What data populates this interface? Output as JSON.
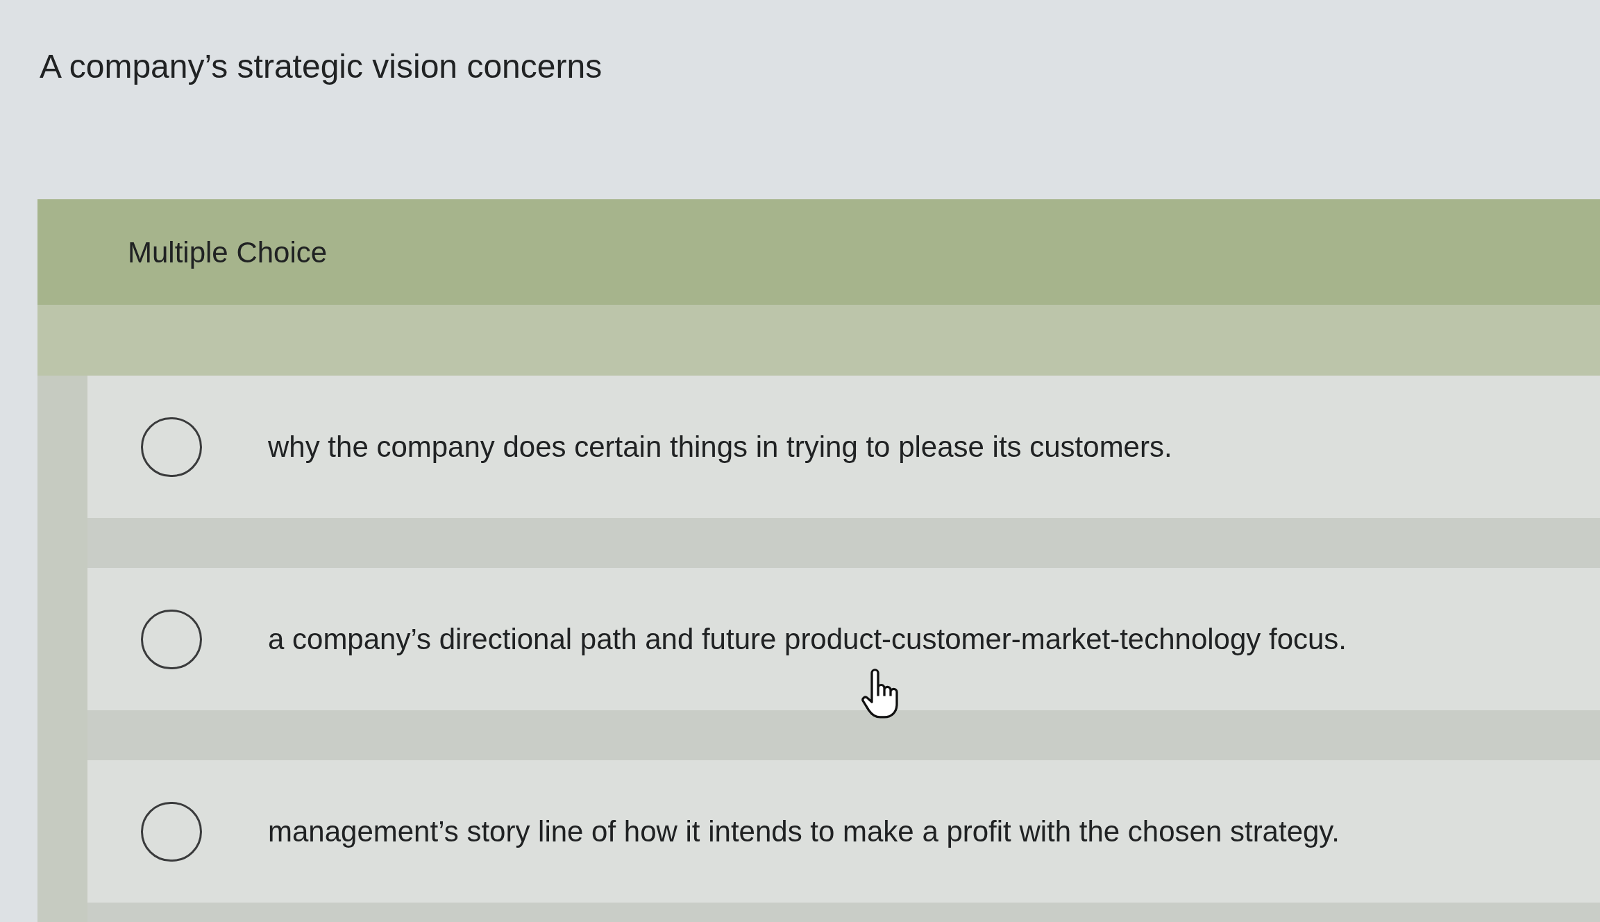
{
  "question": {
    "text": "A company’s strategic vision concerns"
  },
  "panel": {
    "title": "Multiple Choice"
  },
  "options": [
    {
      "label": "why the company does certain things in trying to please its customers.",
      "selected": false
    },
    {
      "label": "a company’s directional path and future product-customer-market-technology focus.",
      "selected": false
    },
    {
      "label": "management’s story line of how it intends to make a profit with the chosen strategy.",
      "selected": false
    }
  ]
}
